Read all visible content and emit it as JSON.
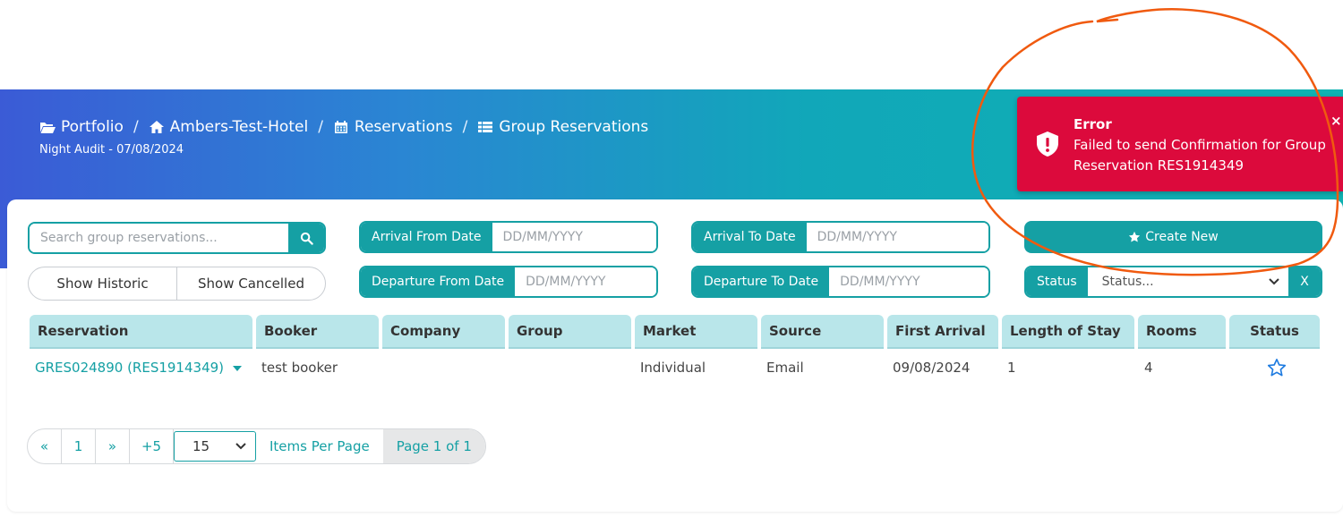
{
  "breadcrumb": {
    "portfolio": "Portfolio",
    "hotel": "Ambers-Test-Hotel",
    "reservations": "Reservations",
    "group_reservations": "Group Reservations",
    "separator": "/"
  },
  "night_audit": "Night Audit - 07/08/2024",
  "filters": {
    "search_placeholder": "Search group reservations...",
    "show_historic": "Show Historic",
    "show_cancelled": "Show Cancelled",
    "arrival_from_label": "Arrival From Date",
    "arrival_to_label": "Arrival To Date",
    "departure_from_label": "Departure From Date",
    "departure_to_label": "Departure To Date",
    "date_placeholder": "DD/MM/YYYY",
    "create_new": "Create New",
    "status_label": "Status",
    "status_value": "Status...",
    "status_clear": "X"
  },
  "table": {
    "headers": [
      "Reservation",
      "Booker",
      "Company",
      "Group",
      "Market",
      "Source",
      "First Arrival",
      "Length of Stay",
      "Rooms",
      "Status"
    ],
    "rows": [
      {
        "reservation": "GRES024890 (RES1914349)",
        "booker": "test booker",
        "company": "",
        "group": "",
        "market": "Individual",
        "source": "Email",
        "first_arrival": "09/08/2024",
        "length_of_stay": "1",
        "rooms": "4",
        "status_icon": "star-outline-icon"
      }
    ]
  },
  "pagination": {
    "first": "«",
    "page": "1",
    "next": "»",
    "plus5": "+5",
    "per_page_value": "15",
    "items_per_page": "Items Per Page",
    "page_info": "Page 1 of 1"
  },
  "toast": {
    "title": "Error",
    "message": "Failed to send Confirmation for Group Reservation RES1914349",
    "close": "×"
  },
  "colors": {
    "accent": "#15a0a4",
    "header_bg": "#b9e6ea",
    "error": "#dc0a3c",
    "annotation": "#f05a0f"
  }
}
